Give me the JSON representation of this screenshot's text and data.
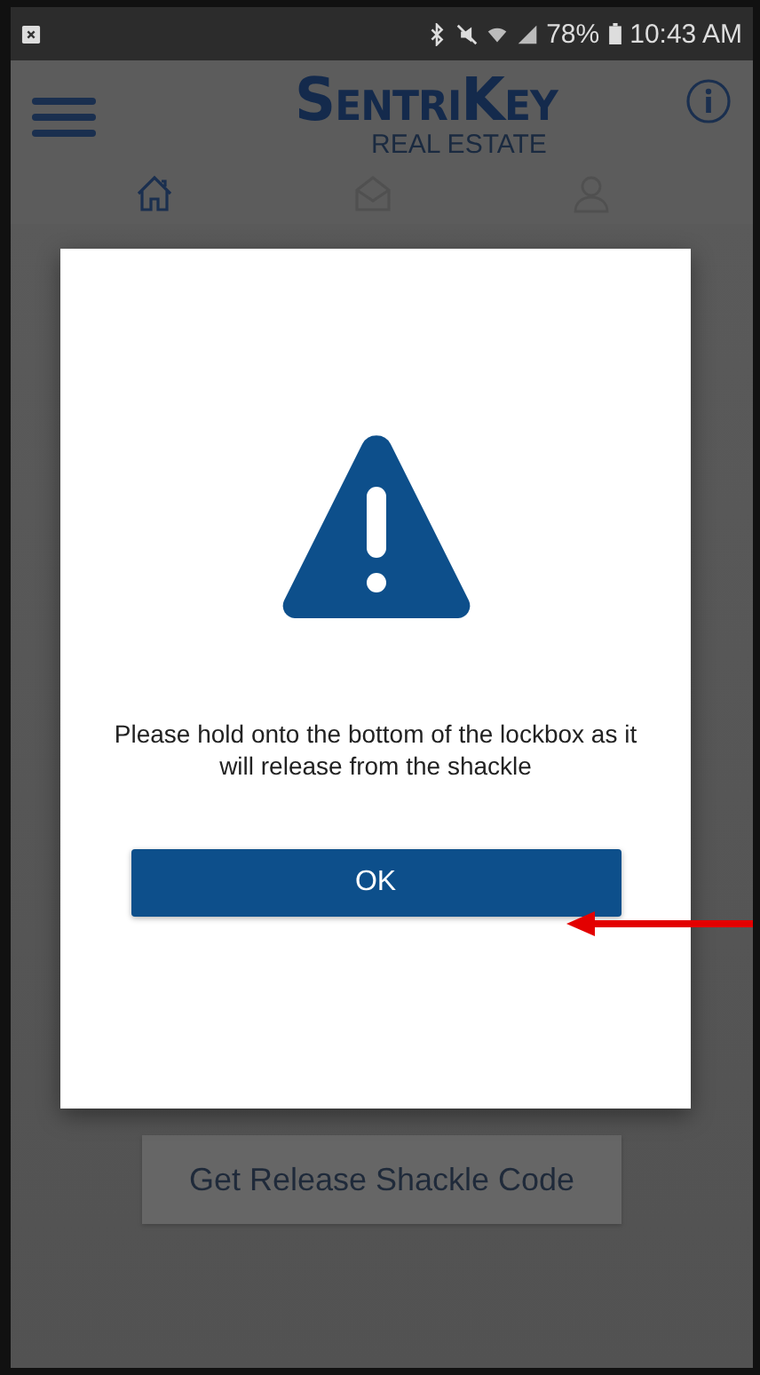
{
  "status_bar": {
    "battery": "78%",
    "time": "10:43 AM"
  },
  "header": {
    "logo": "SentriKey",
    "logo_subtitle": "REAL ESTATE"
  },
  "tabs": [
    {
      "kind": "home",
      "selected": true
    },
    {
      "kind": "mail",
      "selected": false
    },
    {
      "kind": "user",
      "selected": false
    }
  ],
  "page": {
    "button": "Get Release Shackle Code"
  },
  "dialog": {
    "message": "Please hold onto the bottom of the lockbox as it will release from the shackle",
    "button": "OK"
  }
}
